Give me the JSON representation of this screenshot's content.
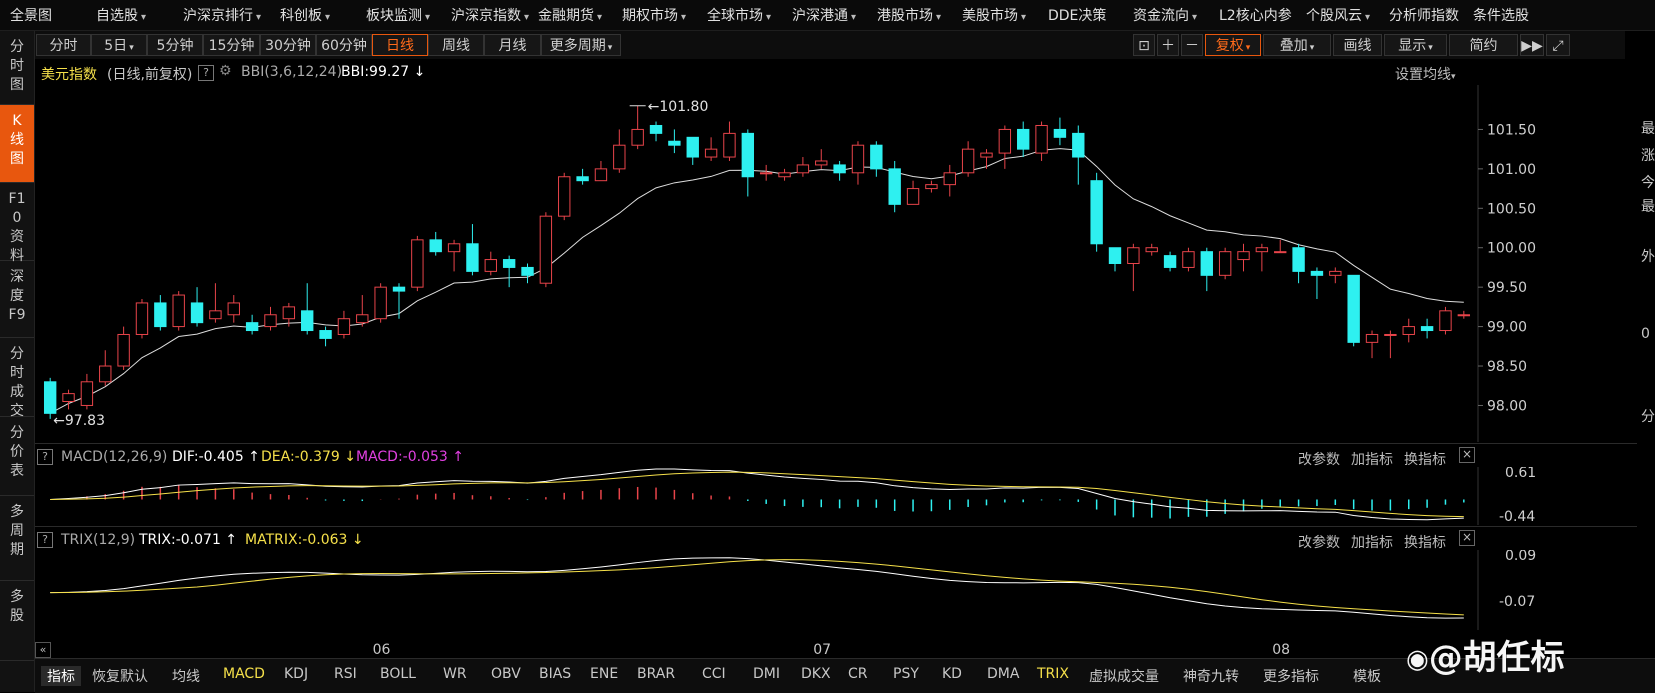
{
  "top_menu": [
    {
      "label": "全景图",
      "caret": false
    },
    {
      "label": "自选股",
      "caret": true
    },
    {
      "label": "沪深京排行",
      "caret": true
    },
    {
      "label": "科创板",
      "caret": true
    },
    {
      "label": "板块监测",
      "caret": true
    },
    {
      "label": "沪深京指数",
      "caret": true
    },
    {
      "label": "金融期货",
      "caret": true
    },
    {
      "label": "期权市场",
      "caret": true
    },
    {
      "label": "全球市场",
      "caret": true
    },
    {
      "label": "沪深港通",
      "caret": true
    },
    {
      "label": "港股市场",
      "caret": true
    },
    {
      "label": "美股市场",
      "caret": true
    },
    {
      "label": "DDE决策",
      "caret": false
    },
    {
      "label": "资金流向",
      "caret": true
    },
    {
      "label": "L2核心内参",
      "caret": false
    },
    {
      "label": "个股风云",
      "caret": true
    },
    {
      "label": "分析师指数",
      "caret": false
    },
    {
      "label": "条件选股",
      "caret": false
    }
  ],
  "left_nav": [
    {
      "label": "分时图",
      "active": false
    },
    {
      "label": "K线图",
      "active": true
    },
    {
      "label": "F10资料",
      "active": false
    },
    {
      "label": "深度F9",
      "active": false
    },
    {
      "label": "分时成交",
      "active": false
    },
    {
      "label": "分价表",
      "active": false
    },
    {
      "label": "多周期",
      "active": false
    },
    {
      "label": "多股",
      "active": false
    }
  ],
  "toolbar": {
    "periods": [
      {
        "label": "分时",
        "caret": false,
        "active": false
      },
      {
        "label": "5日",
        "caret": true,
        "active": false
      },
      {
        "label": "5分钟",
        "caret": false,
        "active": false
      },
      {
        "label": "15分钟",
        "caret": false,
        "active": false
      },
      {
        "label": "30分钟",
        "caret": false,
        "active": false
      },
      {
        "label": "60分钟",
        "caret": false,
        "active": false
      },
      {
        "label": "日线",
        "caret": false,
        "active": true
      },
      {
        "label": "周线",
        "caret": false,
        "active": false
      },
      {
        "label": "月线",
        "caret": false,
        "active": false
      },
      {
        "label": "更多周期",
        "caret": true,
        "active": false
      }
    ],
    "right": [
      {
        "label": "复权",
        "caret": true,
        "active": true
      },
      {
        "label": "叠加",
        "caret": true,
        "active": false
      },
      {
        "label": "画线",
        "caret": false,
        "active": false
      },
      {
        "label": "显示",
        "caret": true,
        "active": false
      },
      {
        "label": "简约",
        "caret": false,
        "active": false
      }
    ]
  },
  "main_panel": {
    "title": "美元指数",
    "mode": "(日线,前复权)",
    "indicator": "BBI(3,6,12,24)",
    "indicator_value": "BBI:99.27 ↓",
    "settings_label": "设置均线",
    "high_label": "101.80",
    "low_label": "97.83"
  },
  "macd_panel": {
    "name": "MACD(12,26,9)",
    "dif": "DIF:-0.405 ↑",
    "dea": "DEA:-0.379 ↓",
    "macd": "MACD:-0.053 ↑",
    "y_labels": [
      "0.61",
      "-0.44"
    ],
    "buttons": [
      "改参数",
      "加指标",
      "换指标"
    ]
  },
  "trix_panel": {
    "name": "TRIX(12,9)",
    "trix": "TRIX:-0.071 ↑",
    "matrix": "MATRIX:-0.063 ↓",
    "y_labels": [
      "0.09",
      "-0.07"
    ],
    "buttons": [
      "改参数",
      "加指标",
      "换指标"
    ]
  },
  "x_axis": [
    "06",
    "07",
    "08"
  ],
  "bottom_tabs": [
    {
      "label": "指标",
      "active": true,
      "yellow": false
    },
    {
      "label": "恢复默认",
      "active": false,
      "yellow": false
    },
    {
      "label": "均线",
      "active": false,
      "yellow": false
    },
    {
      "label": "MACD",
      "active": false,
      "yellow": true
    },
    {
      "label": "KDJ",
      "active": false,
      "yellow": false
    },
    {
      "label": "RSI",
      "active": false,
      "yellow": false
    },
    {
      "label": "BOLL",
      "active": false,
      "yellow": false
    },
    {
      "label": "WR",
      "active": false,
      "yellow": false
    },
    {
      "label": "OBV",
      "active": false,
      "yellow": false
    },
    {
      "label": "BIAS",
      "active": false,
      "yellow": false
    },
    {
      "label": "ENE",
      "active": false,
      "yellow": false
    },
    {
      "label": "BRAR",
      "active": false,
      "yellow": false
    },
    {
      "label": "CCI",
      "active": false,
      "yellow": false
    },
    {
      "label": "DMI",
      "active": false,
      "yellow": false
    },
    {
      "label": "DKX",
      "active": false,
      "yellow": false
    },
    {
      "label": "CR",
      "active": false,
      "yellow": false
    },
    {
      "label": "PSY",
      "active": false,
      "yellow": false
    },
    {
      "label": "KD",
      "active": false,
      "yellow": false
    },
    {
      "label": "DMA",
      "active": false,
      "yellow": false
    },
    {
      "label": "TRIX",
      "active": false,
      "yellow": true
    },
    {
      "label": "虚拟成交量",
      "active": false,
      "yellow": false
    },
    {
      "label": "神奇九转",
      "active": false,
      "yellow": false
    },
    {
      "label": "更多指标",
      "active": false,
      "yellow": false
    },
    {
      "label": "模板",
      "active": false,
      "yellow": false
    }
  ],
  "right_strip": [
    "最",
    "涨",
    "今",
    "最",
    "外",
    "0",
    "分"
  ],
  "watermark": "@胡任标",
  "chart_data": {
    "type": "candlestick",
    "y_ticks": [
      98.0,
      98.5,
      99.0,
      99.5,
      100.0,
      100.5,
      101.0,
      101.5
    ],
    "y_tick_labels": [
      "98.00",
      "98.50",
      "99.00",
      "99.50",
      "100.00",
      "100.50",
      "101.00",
      "101.50"
    ],
    "ylim": [
      97.6,
      102.0
    ],
    "candles": [
      [
        98.3,
        97.9,
        98.35,
        97.83
      ],
      [
        98.05,
        98.15,
        98.2,
        97.95
      ],
      [
        98.0,
        98.3,
        98.4,
        97.95
      ],
      [
        98.3,
        98.5,
        98.7,
        98.25
      ],
      [
        98.5,
        98.9,
        99.0,
        98.45
      ],
      [
        98.9,
        99.3,
        99.35,
        98.85
      ],
      [
        99.3,
        99.0,
        99.4,
        98.95
      ],
      [
        99.0,
        99.4,
        99.45,
        98.95
      ],
      [
        99.3,
        99.05,
        99.5,
        99.0
      ],
      [
        99.1,
        99.2,
        99.55,
        99.05
      ],
      [
        99.15,
        99.3,
        99.4,
        99.05
      ],
      [
        99.05,
        98.95,
        99.15,
        98.9
      ],
      [
        99.0,
        99.15,
        99.25,
        98.95
      ],
      [
        99.1,
        99.25,
        99.3,
        99.0
      ],
      [
        99.2,
        98.95,
        99.55,
        98.9
      ],
      [
        98.95,
        98.85,
        99.0,
        98.75
      ],
      [
        98.9,
        99.1,
        99.2,
        98.85
      ],
      [
        99.05,
        99.15,
        99.4,
        99.0
      ],
      [
        99.1,
        99.5,
        99.55,
        99.05
      ],
      [
        99.5,
        99.45,
        99.55,
        99.1
      ],
      [
        99.5,
        100.1,
        100.15,
        99.45
      ],
      [
        100.1,
        99.95,
        100.2,
        99.9
      ],
      [
        99.95,
        100.05,
        100.1,
        99.7
      ],
      [
        100.05,
        99.7,
        100.3,
        99.65
      ],
      [
        99.7,
        99.85,
        99.95,
        99.65
      ],
      [
        99.85,
        99.75,
        99.9,
        99.5
      ],
      [
        99.75,
        99.65,
        99.8,
        99.55
      ],
      [
        99.55,
        100.4,
        100.45,
        99.5
      ],
      [
        100.4,
        100.9,
        100.95,
        100.35
      ],
      [
        100.9,
        100.85,
        101.0,
        100.8
      ],
      [
        100.85,
        101.0,
        101.1,
        100.85
      ],
      [
        101.0,
        101.3,
        101.5,
        100.95
      ],
      [
        101.3,
        101.5,
        101.8,
        101.25
      ],
      [
        101.55,
        101.45,
        101.6,
        101.35
      ],
      [
        101.35,
        101.3,
        101.5,
        101.2
      ],
      [
        101.4,
        101.15,
        101.35,
        101.05
      ],
      [
        101.15,
        101.25,
        101.4,
        101.1
      ],
      [
        101.15,
        101.45,
        101.6,
        101.1
      ],
      [
        101.45,
        100.9,
        101.5,
        100.65
      ],
      [
        100.95,
        100.95,
        101.05,
        100.85
      ],
      [
        100.9,
        100.95,
        101.0,
        100.85
      ],
      [
        100.95,
        101.05,
        101.15,
        100.9
      ],
      [
        101.05,
        101.1,
        101.25,
        101.0
      ],
      [
        101.05,
        100.95,
        101.1,
        100.85
      ],
      [
        100.95,
        101.3,
        101.35,
        100.8
      ],
      [
        101.3,
        101.0,
        101.35,
        100.9
      ],
      [
        101.0,
        100.55,
        101.1,
        100.45
      ],
      [
        100.55,
        100.75,
        100.85,
        100.55
      ],
      [
        100.75,
        100.8,
        100.85,
        100.7
      ],
      [
        100.8,
        100.95,
        101.05,
        100.65
      ],
      [
        100.95,
        101.25,
        101.35,
        100.9
      ],
      [
        101.15,
        101.2,
        101.25,
        101.0
      ],
      [
        101.2,
        101.5,
        101.55,
        101.0
      ],
      [
        101.5,
        101.25,
        101.6,
        101.15
      ],
      [
        101.2,
        101.55,
        101.6,
        101.1
      ],
      [
        101.5,
        101.4,
        101.65,
        101.3
      ],
      [
        101.45,
        101.15,
        101.55,
        100.8
      ],
      [
        100.85,
        100.05,
        100.95,
        99.95
      ],
      [
        100.0,
        99.8,
        100.0,
        99.7
      ],
      [
        99.8,
        100.0,
        100.05,
        99.45
      ],
      [
        99.95,
        100.0,
        100.05,
        99.9
      ],
      [
        99.9,
        99.75,
        99.95,
        99.7
      ],
      [
        99.75,
        99.95,
        100.0,
        99.7
      ],
      [
        99.95,
        99.65,
        100.0,
        99.45
      ],
      [
        99.65,
        99.95,
        100.0,
        99.6
      ],
      [
        99.85,
        99.95,
        100.05,
        99.7
      ],
      [
        99.95,
        100.0,
        100.05,
        99.7
      ],
      [
        99.95,
        99.95,
        100.1,
        99.95
      ],
      [
        100.0,
        99.7,
        100.05,
        99.55
      ],
      [
        99.7,
        99.65,
        99.75,
        99.35
      ],
      [
        99.65,
        99.7,
        99.75,
        99.55
      ],
      [
        99.65,
        98.8,
        99.65,
        98.75
      ],
      [
        98.8,
        98.9,
        98.95,
        98.6
      ],
      [
        98.9,
        98.9,
        98.95,
        98.6
      ],
      [
        98.9,
        99.0,
        99.1,
        98.8
      ],
      [
        99.0,
        98.95,
        99.1,
        98.85
      ],
      [
        98.95,
        99.2,
        99.25,
        98.9
      ],
      [
        99.15,
        99.15,
        99.2,
        99.1
      ]
    ],
    "macd_ylim": [
      -0.55,
      0.7
    ],
    "trix_ylim": [
      -0.085,
      0.1
    ],
    "x_tick_index": {
      "06": 18,
      "07": 42,
      "08": 67
    }
  }
}
